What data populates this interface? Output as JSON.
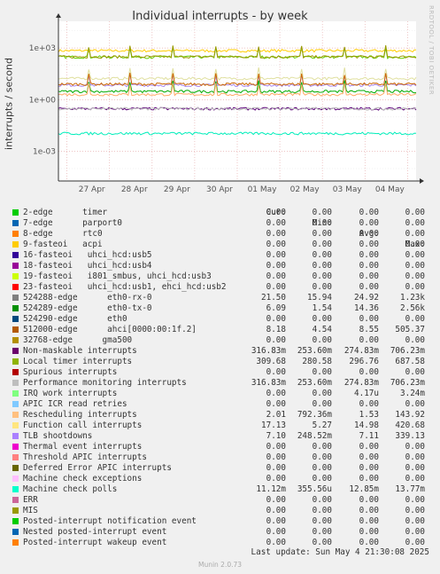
{
  "chart_data": {
    "type": "line",
    "title": "Individual interrupts - by week",
    "ylabel": "interrupts / second",
    "xlabel": "",
    "y_scale": "log",
    "y_ticks": [
      "1e+03",
      "1e+00",
      "1e-03"
    ],
    "x_ticks": [
      "27 Apr",
      "28 Apr",
      "29 Apr",
      "30 Apr",
      "01 May",
      "02 May",
      "03 May",
      "04 May"
    ],
    "grid": true,
    "legend_placement": "bottom",
    "series_hint": [
      {
        "name": "524288-edge eth0-rx-0",
        "level": 700,
        "color": "#fc0"
      },
      {
        "name": "Posted-interrupt notification event",
        "level": 300,
        "color": "#66cc00"
      },
      {
        "name": "Local timer interrupts",
        "level": 310,
        "color": "#999900"
      },
      {
        "name": "Function call interrupts",
        "level": 17,
        "color": "#e0e0a0"
      },
      {
        "name": "TLB shootdowns",
        "level": 7,
        "color": "#aa88ee"
      },
      {
        "name": "512000-edge ahci",
        "level": 8,
        "color": "#cc6600"
      },
      {
        "name": "524289-edge eth0-tx-0",
        "level": 3,
        "color": "#00aa00"
      },
      {
        "name": "Rescheduling interrupts",
        "level": 2,
        "color": "#ffaa66"
      },
      {
        "name": "Non-maskable interrupts",
        "level": 0.3,
        "color": "#5c007a"
      },
      {
        "name": "Performance monitoring interrupts",
        "level": 0.3,
        "color": "#bbbbbb"
      },
      {
        "name": "Machine check polls",
        "level": 0.011,
        "color": "#00eebb"
      }
    ]
  },
  "watermark": "RRDTOOL / TOBI OETIKER",
  "legend_header": {
    "cur": "Cur:",
    "min": "Min:",
    "avg": "Avg:",
    "max": "Max:"
  },
  "legend": [
    {
      "name": "2-edge      timer",
      "color": "#00cc00",
      "cur": "0.00",
      "min": "0.00",
      "avg": "0.00",
      "max": "0.00"
    },
    {
      "name": "7-edge      parport0",
      "color": "#0066b3",
      "cur": "0.00",
      "min": "0.00",
      "avg": "0.00",
      "max": "0.00"
    },
    {
      "name": "8-edge      rtc0",
      "color": "#ff8000",
      "cur": "0.00",
      "min": "0.00",
      "avg": "0.00",
      "max": "0.00"
    },
    {
      "name": "9-fasteoi   acpi",
      "color": "#ffcc00",
      "cur": "0.00",
      "min": "0.00",
      "avg": "0.00",
      "max": "0.00"
    },
    {
      "name": "16-fasteoi   uhci_hcd:usb5",
      "color": "#330099",
      "cur": "0.00",
      "min": "0.00",
      "avg": "0.00",
      "max": "0.00"
    },
    {
      "name": "18-fasteoi   uhci_hcd:usb4",
      "color": "#990099",
      "cur": "0.00",
      "min": "0.00",
      "avg": "0.00",
      "max": "0.00"
    },
    {
      "name": "19-fasteoi   i801_smbus, uhci_hcd:usb3",
      "color": "#ccff00",
      "cur": "0.00",
      "min": "0.00",
      "avg": "0.00",
      "max": "0.00"
    },
    {
      "name": "23-fasteoi   uhci_hcd:usb1, ehci_hcd:usb2",
      "color": "#ff0000",
      "cur": "0.00",
      "min": "0.00",
      "avg": "0.00",
      "max": "0.00"
    },
    {
      "name": "524288-edge      eth0-rx-0",
      "color": "#808080",
      "cur": "21.50",
      "min": "15.94",
      "avg": "24.92",
      "max": "1.23k"
    },
    {
      "name": "524289-edge      eth0-tx-0",
      "color": "#008f00",
      "cur": "6.09",
      "min": "1.54",
      "avg": "14.36",
      "max": "2.56k"
    },
    {
      "name": "524290-edge      eth0",
      "color": "#00487d",
      "cur": "0.00",
      "min": "0.00",
      "avg": "0.00",
      "max": "0.00"
    },
    {
      "name": "512000-edge      ahci[0000:00:1f.2]",
      "color": "#b35a00",
      "cur": "8.18",
      "min": "4.54",
      "avg": "8.55",
      "max": "505.37"
    },
    {
      "name": "32768-edge      gma500",
      "color": "#b38f00",
      "cur": "0.00",
      "min": "0.00",
      "avg": "0.00",
      "max": "0.00"
    },
    {
      "name": "Non-maskable interrupts",
      "color": "#6b006b",
      "cur": "316.83m",
      "min": "253.60m",
      "avg": "274.83m",
      "max": "706.23m"
    },
    {
      "name": "Local timer interrupts",
      "color": "#8fb300",
      "cur": "309.68",
      "min": "280.58",
      "avg": "296.76",
      "max": "687.58"
    },
    {
      "name": "Spurious interrupts",
      "color": "#b30000",
      "cur": "0.00",
      "min": "0.00",
      "avg": "0.00",
      "max": "0.00"
    },
    {
      "name": "Performance monitoring interrupts",
      "color": "#bebebe",
      "cur": "316.83m",
      "min": "253.60m",
      "avg": "274.83m",
      "max": "706.23m"
    },
    {
      "name": "IRQ work interrupts",
      "color": "#80ff80",
      "cur": "0.00",
      "min": "0.00",
      "avg": "4.17u",
      "max": "3.24m"
    },
    {
      "name": "APIC ICR read retries",
      "color": "#80c9ff",
      "cur": "0.00",
      "min": "0.00",
      "avg": "0.00",
      "max": "0.00"
    },
    {
      "name": "Rescheduling interrupts",
      "color": "#ffc080",
      "cur": "2.01",
      "min": "792.36m",
      "avg": "1.53",
      "max": "143.92"
    },
    {
      "name": "Function call interrupts",
      "color": "#ffe680",
      "cur": "17.13",
      "min": "5.27",
      "avg": "14.98",
      "max": "420.68"
    },
    {
      "name": "TLB shootdowns",
      "color": "#aa80ff",
      "cur": "7.10",
      "min": "248.52m",
      "avg": "7.11",
      "max": "339.13"
    },
    {
      "name": "Thermal event interrupts",
      "color": "#ee00cc",
      "cur": "0.00",
      "min": "0.00",
      "avg": "0.00",
      "max": "0.00"
    },
    {
      "name": "Threshold APIC interrupts",
      "color": "#ff8080",
      "cur": "0.00",
      "min": "0.00",
      "avg": "0.00",
      "max": "0.00"
    },
    {
      "name": "Deferred Error APIC interrupts",
      "color": "#666600",
      "cur": "0.00",
      "min": "0.00",
      "avg": "0.00",
      "max": "0.00"
    },
    {
      "name": "Machine check exceptions",
      "color": "#ffbfff",
      "cur": "0.00",
      "min": "0.00",
      "avg": "0.00",
      "max": "0.00"
    },
    {
      "name": "Machine check polls",
      "color": "#00ffcc",
      "cur": "11.12m",
      "min": "355.56u",
      "avg": "12.85m",
      "max": "13.77m"
    },
    {
      "name": "ERR",
      "color": "#cc6699",
      "cur": "0.00",
      "min": "0.00",
      "avg": "0.00",
      "max": "0.00"
    },
    {
      "name": "MIS",
      "color": "#999900",
      "cur": "0.00",
      "min": "0.00",
      "avg": "0.00",
      "max": "0.00"
    },
    {
      "name": "Posted-interrupt notification event",
      "color": "#00cc00",
      "cur": "0.00",
      "min": "0.00",
      "avg": "0.00",
      "max": "0.00"
    },
    {
      "name": "Nested posted-interrupt event",
      "color": "#0066b3",
      "cur": "0.00",
      "min": "0.00",
      "avg": "0.00",
      "max": "0.00"
    },
    {
      "name": "Posted-interrupt wakeup event",
      "color": "#ff8000",
      "cur": "0.00",
      "min": "0.00",
      "avg": "0.00",
      "max": "0.00"
    }
  ],
  "footer": "Last update: Sun May  4 21:30:08 2025",
  "munin_version": "Munin 2.0.73"
}
